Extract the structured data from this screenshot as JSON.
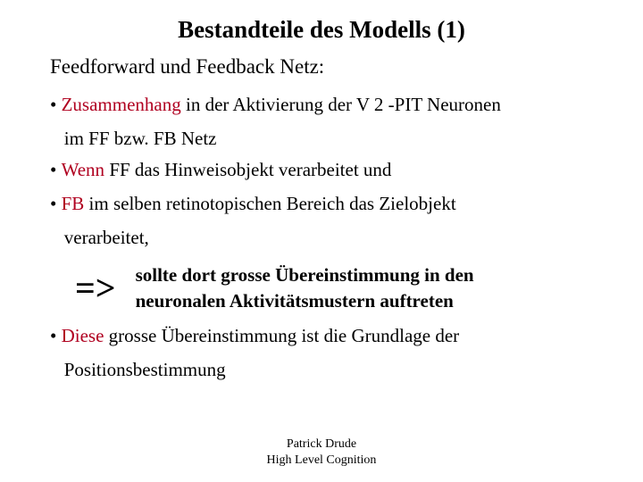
{
  "title": "Bestandteile des Modells (1)",
  "subtitle": "Feedforward und Feedback Netz:",
  "bullets": {
    "b1": {
      "hl": "Zusammenhang",
      "rest": " in der Aktivierung der V 2 -PIT Neuronen",
      "cont": "im FF bzw. FB Netz"
    },
    "b2": {
      "hl": "Wenn",
      "rest": " FF das Hinweisobjekt verarbeitet und"
    },
    "b3": {
      "hl": "FB",
      "rest": " im selben retinotopischen Bereich das Zielobjekt",
      "cont": "verarbeitet,"
    },
    "arrow": {
      "symbol": "=>",
      "line1": "sollte dort grosse Übereinstimmung in den",
      "line2": "neuronalen Aktivitätsmustern auftreten"
    },
    "b4": {
      "hl": "Diese",
      "rest": " grosse Übereinstimmung ist die Grundlage der",
      "cont": "Positionsbestimmung"
    }
  },
  "footer": {
    "line1": "Patrick Drude",
    "line2": "High Level Cognition"
  },
  "bullet_char": "•"
}
